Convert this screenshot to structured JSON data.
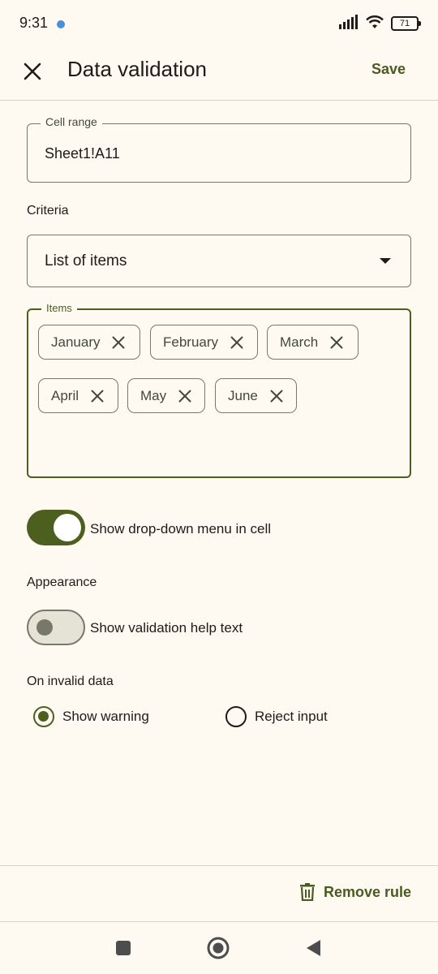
{
  "status_bar": {
    "time": "9:31",
    "battery": "71"
  },
  "app_bar": {
    "title": "Data validation",
    "save_label": "Save"
  },
  "cell_range": {
    "label": "Cell range",
    "value": "Sheet1!A11"
  },
  "criteria": {
    "label": "Criteria",
    "selected": "List of items"
  },
  "items": {
    "label": "Items",
    "chips": [
      "January",
      "February",
      "March",
      "April",
      "May",
      "June"
    ]
  },
  "dropdown_toggle": {
    "label": "Show drop-down menu in cell",
    "on": true
  },
  "appearance": {
    "label": "Appearance",
    "help_text_toggle": {
      "label": "Show validation help text",
      "on": false
    }
  },
  "invalid_data": {
    "label": "On invalid data",
    "options": [
      "Show warning",
      "Reject input"
    ],
    "selected": "Show warning"
  },
  "footer": {
    "remove_label": "Remove rule"
  },
  "colors": {
    "accent": "#4d5f1f",
    "background": "#fefaf1",
    "outline": "#77786a"
  },
  "icons": {
    "close": "close-icon",
    "dropdown": "arrow-drop-down-icon",
    "chip_remove": "close-icon",
    "remove_rule": "trash-icon",
    "nav": [
      "recents-icon",
      "home-icon",
      "back-icon"
    ]
  }
}
